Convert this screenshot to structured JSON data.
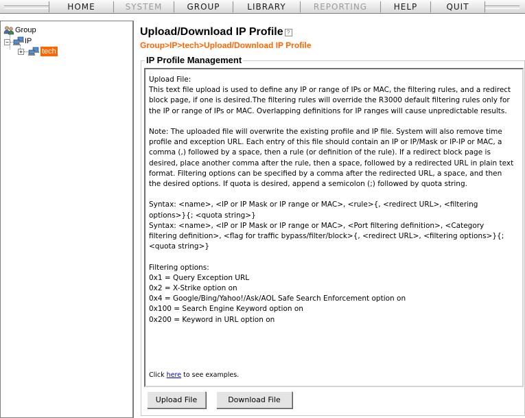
{
  "menu": {
    "items": [
      {
        "label": "HOME",
        "enabled": true
      },
      {
        "label": "SYSTEM",
        "enabled": false
      },
      {
        "label": "GROUP",
        "enabled": true
      },
      {
        "label": "LIBRARY",
        "enabled": true
      },
      {
        "label": "REPORTING",
        "enabled": false
      },
      {
        "label": "HELP",
        "enabled": true
      },
      {
        "label": "QUIT",
        "enabled": true
      }
    ]
  },
  "tree": {
    "root": "Group",
    "child": "IP",
    "grandchild": "tech",
    "selected": "tech",
    "selected_color": "#ff6600"
  },
  "page": {
    "title": "Upload/Download IP Profile",
    "help_glyph": "?",
    "breadcrumb": "Group>IP>tech>Upload/Download IP Profile",
    "breadcrumb_color": "#ff6600",
    "section_title": "IP Profile Management"
  },
  "description": {
    "lines": [
      "Upload File:",
      "This text file upload is used to define any IP or range of IPs or MAC, the filtering rules, and a redirect",
      "block page, if one is desired.The filtering rules will override the R3000 default filtering rules only for",
      "the IP or range of IPs or MAC. Overlapping definitions for IP ranges will cause unpredictable results.",
      "",
      "Note: The uploaded file will overwrite the existing profile and IP file. System will also remove time",
      "profile and exception URL. Each entry of this file should contain an IP or IP/Mask or IP-IP or MAC, a",
      "comma (,) followed by a space, then a rule (or definition of the rule). If a redirect block page is",
      "desired, place another comma after the rule, then a space, followed by a redirected URL in plain text",
      "format. Filtering options can be specified by a comma after the redirected URL, a space, and then",
      "the desired options. If quota is desired, append a semicolon (;) followed by quota string.",
      "",
      "Syntax: <name>, <IP or IP Mask or IP range or MAC>, <rule>{, <redirect URL>, <filtering",
      "options>}{; <quota string>}",
      "Syntax: <name>, <IP or IP Mask or IP range or MAC>, <Port filtering definition>, <Category",
      "filtering definition>, <flag for traffic bypass/filter/block>{, <redirect URL>, <filtering options>}{;",
      "<quota string>}",
      "",
      "Filtering options:",
      "0x1 = Query Exception URL",
      "0x2 = X-Strike option on",
      "0x4 = Google/Bing/Yahoo!/Ask/AOL Safe Search Enforcement option on",
      "0x100 = Search Engine Keyword option on",
      "0x200 = Keyword  in URL option on"
    ],
    "click_prefix": "Click ",
    "click_link": "here",
    "click_suffix": " to see examples."
  },
  "buttons": {
    "upload": "Upload File",
    "download": "Download File"
  }
}
